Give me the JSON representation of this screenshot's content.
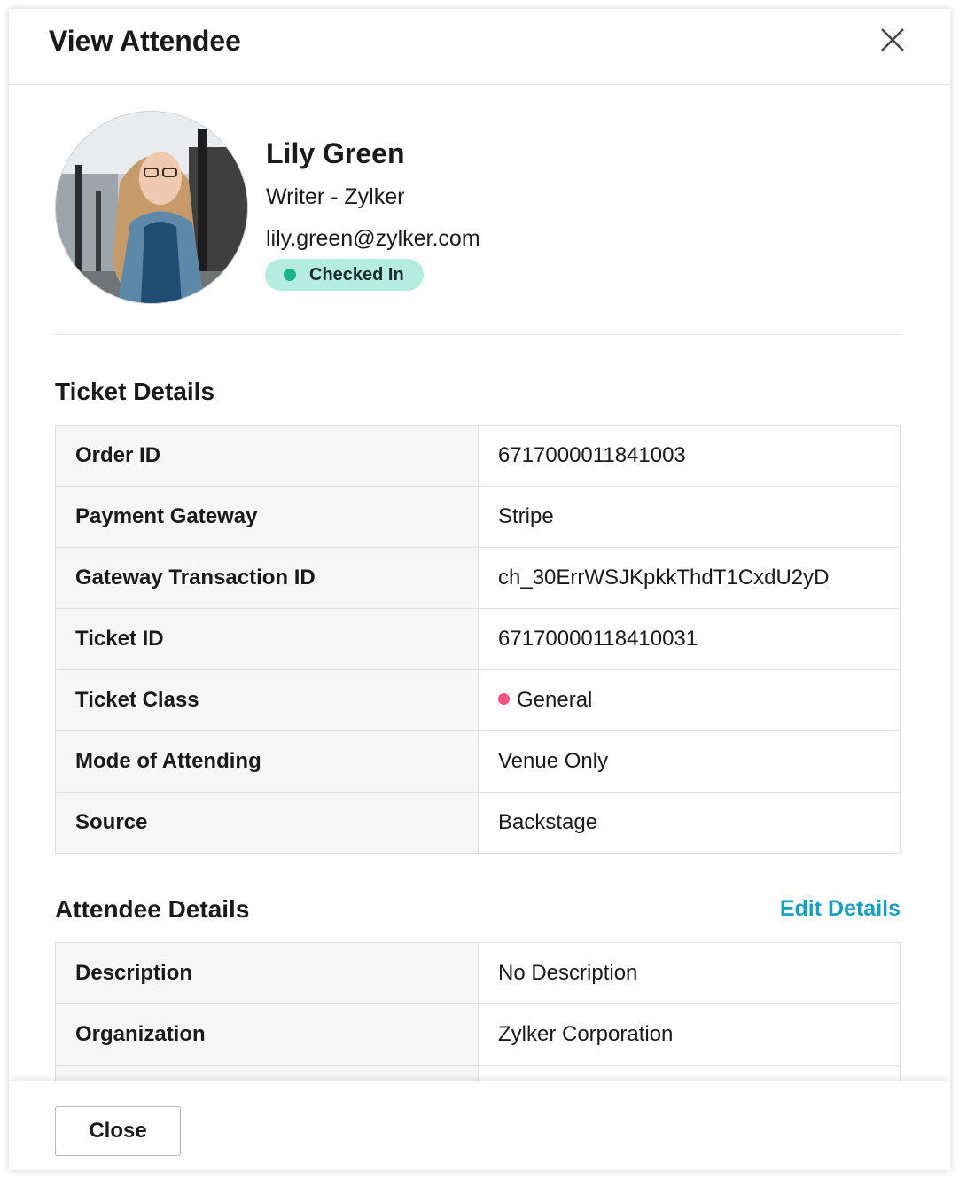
{
  "header": {
    "title": "View Attendee"
  },
  "attendee": {
    "name": "Lily Green",
    "role": "Writer - Zylker",
    "email": "lily.green@zylker.com",
    "status": "Checked In"
  },
  "ticket_details": {
    "title": "Ticket Details",
    "rows": [
      {
        "label": "Order ID",
        "value": "6717000011841003"
      },
      {
        "label": "Payment Gateway",
        "value": "Stripe"
      },
      {
        "label": "Gateway Transaction ID",
        "value": "ch_30ErrWSJKpkkThdT1CxdU2yD"
      },
      {
        "label": "Ticket ID",
        "value": "67170000118410031"
      },
      {
        "label": "Ticket Class",
        "value": "General"
      },
      {
        "label": "Mode of Attending",
        "value": "Venue Only"
      },
      {
        "label": "Source",
        "value": "Backstage"
      }
    ]
  },
  "attendee_details": {
    "title": "Attendee Details",
    "edit_label": "Edit Details",
    "rows": [
      {
        "label": "Description",
        "value": "No Description"
      },
      {
        "label": "Organization",
        "value": "Zylker Corporation"
      }
    ]
  },
  "footer": {
    "close_label": "Close"
  },
  "colors": {
    "status_badge_bg": "#b4ece0",
    "status_dot": "#19b589",
    "ticket_class_dot": "#f2547f",
    "link": "#1a9fbf"
  }
}
